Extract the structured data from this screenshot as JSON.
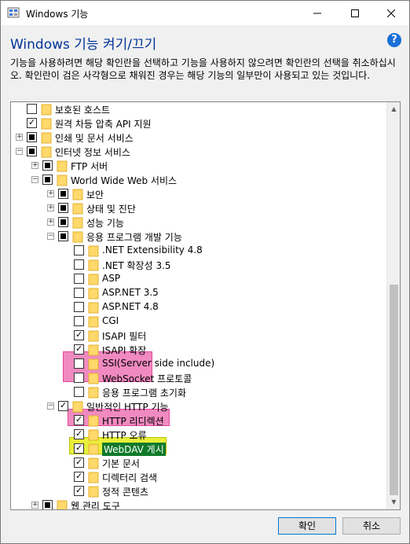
{
  "window": {
    "title": "Windows 기능",
    "minimize_icon": "minimize-icon",
    "maximize_icon": "maximize-icon",
    "close_icon": "close-icon"
  },
  "header": {
    "heading": "Windows 기능 켜기/끄기",
    "help_glyph": "?",
    "description": "기능을 사용하려면 해당 확인란을 선택하고 기능을 사용하지 않으려면 확인란의 선택을 취소하십시오. 확인란이 검은 사각형으로 채워진 경우는 해당 기능의 일부만이 사용되고 있는 것입니다."
  },
  "tree": {
    "items": [
      {
        "label": "보호된 호스트",
        "state": "unchecked",
        "expander": "",
        "level": 0
      },
      {
        "label": "원격 차등 압축 API 지원",
        "state": "checked",
        "expander": "",
        "level": 0
      },
      {
        "label": "인쇄 및 문서 서비스",
        "state": "partial",
        "expander": "+",
        "level": 0
      },
      {
        "label": "인터넷 정보 서비스",
        "state": "partial",
        "expander": "−",
        "level": 0
      },
      {
        "label": "FTP 서버",
        "state": "partial",
        "expander": "+",
        "level": 1
      },
      {
        "label": "World Wide Web 서비스",
        "state": "partial",
        "expander": "−",
        "level": 1
      },
      {
        "label": "보안",
        "state": "partial",
        "expander": "+",
        "level": 2
      },
      {
        "label": "상태 및 진단",
        "state": "partial",
        "expander": "+",
        "level": 2
      },
      {
        "label": "성능 기능",
        "state": "partial",
        "expander": "+",
        "level": 2
      },
      {
        "label": "응용 프로그램 개발 기능",
        "state": "partial",
        "expander": "−",
        "level": 2
      },
      {
        "label": ".NET Extensibility 4.8",
        "state": "unchecked",
        "expander": "",
        "level": 3
      },
      {
        "label": ".NET 확장성 3.5",
        "state": "unchecked",
        "expander": "",
        "level": 3
      },
      {
        "label": "ASP",
        "state": "unchecked",
        "expander": "",
        "level": 3
      },
      {
        "label": "ASP.NET 3.5",
        "state": "unchecked",
        "expander": "",
        "level": 3
      },
      {
        "label": "ASP.NET 4.8",
        "state": "unchecked",
        "expander": "",
        "level": 3
      },
      {
        "label": "CGI",
        "state": "unchecked",
        "expander": "",
        "level": 3
      },
      {
        "label": "ISAPI 필터",
        "state": "checked",
        "expander": "",
        "level": 3
      },
      {
        "label": "ISAPI 확장",
        "state": "checked",
        "expander": "",
        "level": 3
      },
      {
        "label": "SSI(Server side include)",
        "state": "unchecked",
        "expander": "",
        "level": 3
      },
      {
        "label": "WebSocket 프로토콜",
        "state": "unchecked",
        "expander": "",
        "level": 3
      },
      {
        "label": "응용 프로그램 초기화",
        "state": "unchecked",
        "expander": "",
        "level": 3
      },
      {
        "label": "일반적인 HTTP 기능",
        "state": "checked",
        "expander": "−",
        "level": 2
      },
      {
        "label": "HTTP 리디렉션",
        "state": "checked",
        "expander": "",
        "level": 3
      },
      {
        "label": "HTTP 오류",
        "state": "checked",
        "expander": "",
        "level": 3
      },
      {
        "label": "WebDAV 게시",
        "state": "checked",
        "expander": "",
        "level": 3
      },
      {
        "label": "기본 문서",
        "state": "checked",
        "expander": "",
        "level": 3
      },
      {
        "label": "디렉터리 검색",
        "state": "checked",
        "expander": "",
        "level": 3
      },
      {
        "label": "정적 콘텐츠",
        "state": "checked",
        "expander": "",
        "level": 3
      },
      {
        "label": "웹 관리 도구",
        "state": "partial",
        "expander": "+",
        "level": 1
      }
    ]
  },
  "footer": {
    "ok_label": "확인",
    "cancel_label": "취소"
  },
  "colors": {
    "heading": "#003399",
    "highlight_pink": "#f08ac0",
    "highlight_yellow": "#e8f03a",
    "selection": "#0f7a2a"
  }
}
